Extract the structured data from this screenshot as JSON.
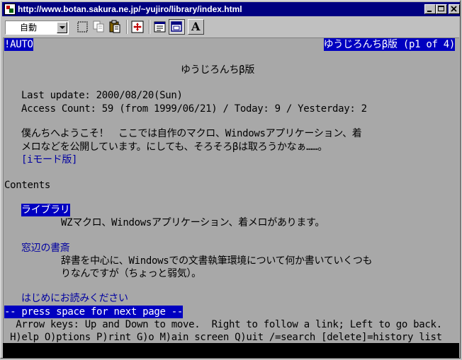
{
  "window": {
    "title": "http://www.botan.sakura.ne.jp/~yujiro/library/index.html"
  },
  "toolbar": {
    "encoding_value": "自動",
    "font_button_label": "A"
  },
  "screen": {
    "status_left": "!AUTO",
    "status_right": "ゆうじろんちβ版 (p1 of 4)",
    "page_heading": "ゆうじろんちβ版",
    "last_update": "Last update: 2000/08/20(Sun)",
    "access_count": "Access Count: 59 (from 1999/06/21) / Today: 9 / Yesterday: 2",
    "welcome_line1": "僕んちへようこそ！　ここでは自作のマクロ、Windowsアプリケーション、着",
    "welcome_line2": "メロなどを公開しています。にしても、そろそろβは取ろうかなぁ……。",
    "imode_link": "[iモード版]",
    "contents_heading": "Contents",
    "sections": [
      {
        "title": "ライブラリ",
        "desc": [
          "WZマクロ、Windowsアプリケーション、着メロがあります。"
        ]
      },
      {
        "title": "窓辺の書斎",
        "desc": [
          "辞書を中心に、Windowsでの文書執筆環境について何か書いていくつも",
          "りなんですが（ちょっと弱気）。"
        ]
      },
      {
        "title": "はじめにお読みください",
        "desc": []
      }
    ],
    "pager_prompt": "-- press space for next page --",
    "help_line1": "  Arrow keys: Up and Down to move.  Right to follow a link; Left to go back.",
    "help_line2": " H)elp O)ptions P)rint G)o M)ain screen Q)uit /=search [delete]=history list"
  }
}
